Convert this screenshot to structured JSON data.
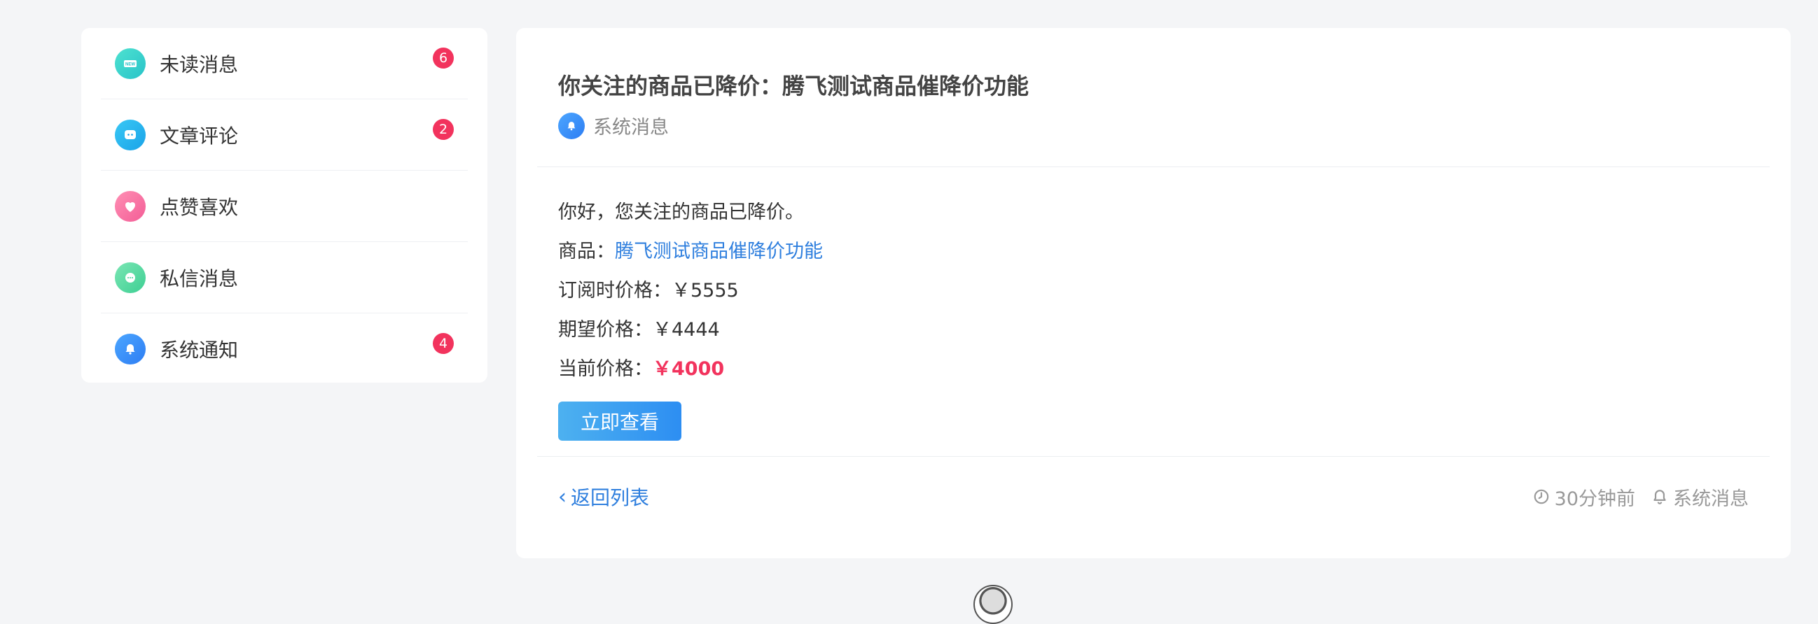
{
  "sidebar": {
    "items": [
      {
        "label": "未读消息",
        "badge": "6",
        "icon": "new-icon"
      },
      {
        "label": "文章评论",
        "badge": "2",
        "icon": "comment-icon"
      },
      {
        "label": "点赞喜欢",
        "badge": "",
        "icon": "heart-icon"
      },
      {
        "label": "私信消息",
        "badge": "",
        "icon": "chat-icon"
      },
      {
        "label": "系统通知",
        "badge": "4",
        "icon": "bell-icon"
      }
    ]
  },
  "message": {
    "title": "你关注的商品已降价：腾飞测试商品催降价功能",
    "source": "系统消息",
    "greeting": "你好，您关注的商品已降价。",
    "product_label": "商品：",
    "product_name": "腾飞测试商品催降价功能",
    "subscribe_price_label": "订阅时价格：",
    "subscribe_price": "￥5555",
    "expected_price_label": "期望价格：",
    "expected_price": "￥4444",
    "current_price_label": "当前价格：",
    "current_price": "￥4000",
    "view_button": "立即查看"
  },
  "footer": {
    "back_label": "返回列表",
    "time": "30分钟前",
    "category": "系统消息"
  },
  "colors": {
    "accent": "#2f7fde",
    "badge": "#f2335d",
    "price": "#f2335d"
  }
}
